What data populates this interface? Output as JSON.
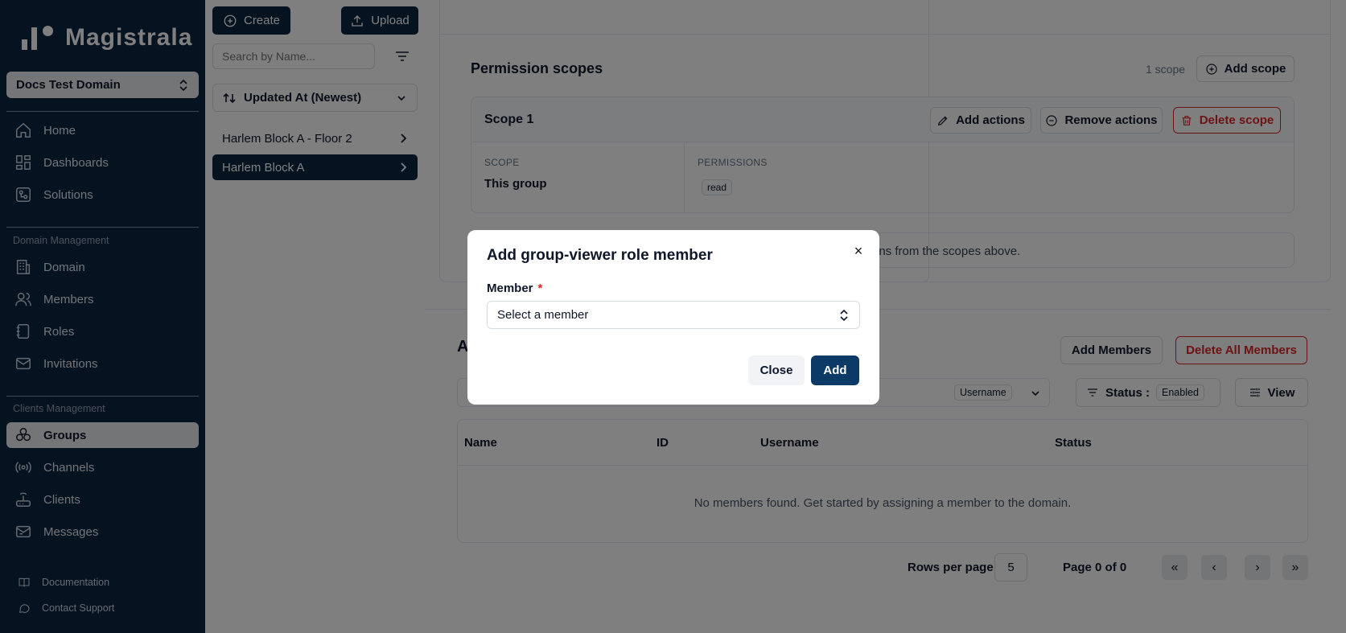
{
  "sidebar": {
    "brand": "Magistrala",
    "domain": "Docs Test Domain",
    "items": [
      {
        "label": "Home"
      },
      {
        "label": "Dashboards"
      },
      {
        "label": "Solutions"
      }
    ],
    "domain_management": {
      "label": "Domain Management",
      "items": [
        {
          "label": "Domain"
        },
        {
          "label": "Members"
        },
        {
          "label": "Roles"
        },
        {
          "label": "Invitations"
        }
      ]
    },
    "clients_management": {
      "label": "Clients Management",
      "items": [
        {
          "label": "Groups"
        },
        {
          "label": "Channels"
        },
        {
          "label": "Clients"
        },
        {
          "label": "Messages"
        }
      ]
    },
    "footer": {
      "documentation": "Documentation",
      "support": "Contact Support"
    }
  },
  "groups_panel": {
    "create_label": "Create",
    "upload_label": "Upload",
    "search_placeholder": "Search by Name...",
    "sort_label": "Updated At (Newest)",
    "items": [
      {
        "label": "Harlem Block A - Floor 2"
      },
      {
        "label": "Harlem Block A"
      }
    ]
  },
  "main": {
    "permission_scopes": {
      "title": "Permission scopes",
      "count": "1 scope",
      "add_scope_label": "Add scope",
      "scope": {
        "title": "Scope 1",
        "add_actions": "Add actions",
        "remove_actions": "Remove actions",
        "delete_scope": "Delete scope",
        "scope_label": "SCOPE",
        "scope_value": "This group",
        "permissions_label": "PERMISSIONS",
        "permissions": [
          "read"
        ]
      },
      "hint_partial": "ons from the scopes above."
    },
    "members": {
      "title_partial": "A",
      "add_members": "Add Members",
      "delete_all": "Delete All Members",
      "username_filter": "Username",
      "status_label": "Status :",
      "status_value": "Enabled",
      "view_label": "View",
      "columns": [
        "Name",
        "ID",
        "Username",
        "Status"
      ],
      "empty": "No members found. Get started by assigning a member to the domain.",
      "rows_per_page_label": "Rows per page",
      "rows_per_page_value": "5",
      "page_info": "Page 0 of 0"
    }
  },
  "modal": {
    "title": "Add group-viewer role member",
    "close_glyph": "×",
    "member_label": "Member",
    "required_mark": "*",
    "member_placeholder": "Select a member",
    "close_label": "Close",
    "add_label": "Add"
  }
}
